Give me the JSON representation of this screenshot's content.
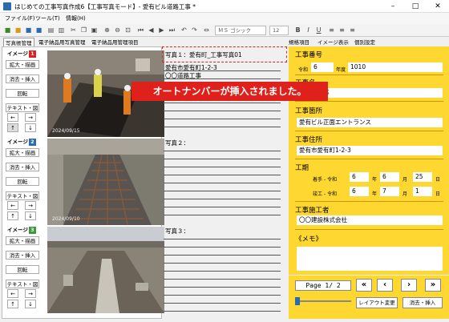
{
  "window": {
    "title": "はじめての工事写真作成6【工事写真モード】- 愛有ビル道路工事 *",
    "minimize": "–",
    "maximize": "□",
    "close": "✕"
  },
  "menu": [
    {
      "label": "ファイル(F)"
    },
    {
      "label": "ツール(T)"
    },
    {
      "label": "情報(H)"
    }
  ],
  "toolbar": {
    "font_name": "ＭＳ ゴシック",
    "font_size": "12"
  },
  "left_tabs": {
    "tab1": "写真帳管理",
    "tab2": "電子納品用写真管理",
    "tab3": "電子納品用管理項目"
  },
  "image_blocks": [
    {
      "label": "イメージ",
      "num": "1",
      "btn1": "拡大・描画",
      "btn2": "消去・挿入",
      "btn3": "回転",
      "btn4": "テキスト・図",
      "photo_stamp": "2024/09/15",
      "note_title": "写真１：愛有町_工事写真01",
      "note_lines": [
        "愛有市愛有町1-2-3",
        "〇〇道路工事"
      ]
    },
    {
      "label": "イメージ",
      "num": "2",
      "btn1": "拡大・描画",
      "btn2": "消去・挿入",
      "btn3": "回転",
      "btn4": "テキスト・図",
      "photo_stamp": "2024/09/10",
      "note_title": "写真２：",
      "note_lines": []
    },
    {
      "label": "イメージ",
      "num": "3",
      "btn1": "拡大・描画",
      "btn2": "消去・挿入",
      "btn3": "回転",
      "btn4": "テキスト・図",
      "photo_stamp": "",
      "note_title": "写真３：",
      "note_lines": []
    }
  ],
  "right_tabs": {
    "tab1": "規格項目",
    "tab2": "イメージ表示",
    "tab3": "個別設定"
  },
  "fields": {
    "koji_bango_label": "工事番号",
    "reiwa": "令和",
    "nendo_value": "6",
    "nendo_label": "年度",
    "koji_bango_value": "1010",
    "koji_mei_label": "工事名",
    "koji_mei_value": "ル道路工事",
    "koji_kasho_label": "工事箇所",
    "koji_kasho_value": "愛有ビル正面エントランス",
    "koji_jusho_label": "工事住所",
    "koji_jusho_value": "愛有市愛有町1-2-3",
    "koki_label": "工期",
    "chakushu_label": "着手",
    "shunko_label": "竣工",
    "reiwa_dash": "- 令和",
    "start_year": "6",
    "start_month": "6",
    "start_day": "25",
    "end_year": "6",
    "end_month": "7",
    "end_day": "1",
    "nen": "年",
    "tsuki": "月",
    "hi": "日",
    "sekosha_label": "工事施工者",
    "sekosha_value": "〇〇建設株式会社",
    "memo_label": "《メモ》"
  },
  "pager": {
    "page_text": "Page 1/ 2",
    "layout_button": "レイアウト変更",
    "erase_insert_button": "消去・挿入",
    "first": "«",
    "prev": "‹",
    "next": "›",
    "last": "»"
  },
  "banner": {
    "text": "オートナンバーが挿入されました。"
  }
}
